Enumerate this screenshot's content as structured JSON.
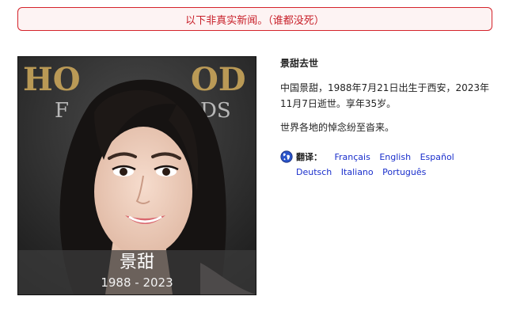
{
  "banner": {
    "text": "以下非真实新闻。（谁都没死）"
  },
  "photo": {
    "name": "景甜",
    "years": "1988 - 2023",
    "background_letters": "HOLLYWOOD F    DS"
  },
  "article": {
    "title": "景甜去世",
    "bio": "中国景甜，1988年7月21日出生于西安，2023年11月7日逝世。享年35岁。",
    "tribute": "世界各地的悼念纷至沓来。"
  },
  "translate": {
    "label": "翻译：",
    "icon": "globe-icon",
    "languages": [
      "Français",
      "English",
      "Español",
      "Deutsch",
      "Italiano",
      "Português"
    ]
  },
  "colors": {
    "banner_border": "#d4232b",
    "banner_text": "#c8202a",
    "link": "#1a2fcc"
  }
}
